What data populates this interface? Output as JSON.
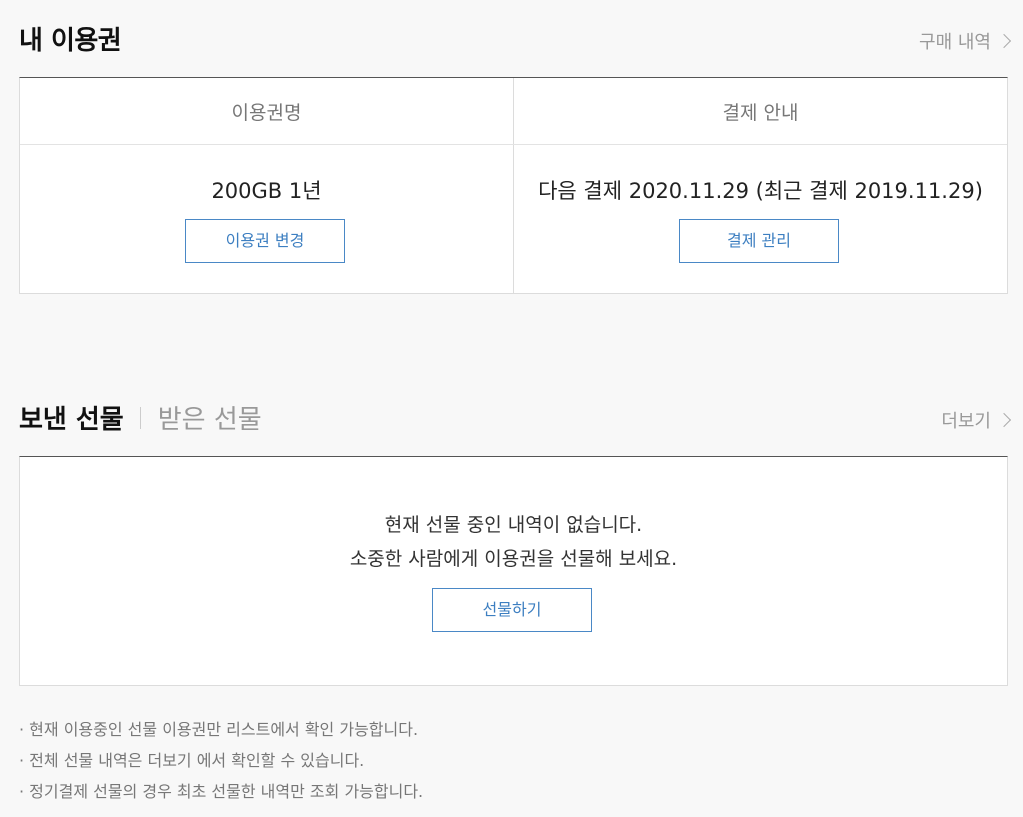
{
  "subscription": {
    "title": "내 이용권",
    "history_link": "구매 내역",
    "col_name_header": "이용권명",
    "col_payment_header": "결제 안내",
    "plan_name": "200GB 1년",
    "payment_info": "다음 결제 2020.11.29 (최근 결제 2019.11.29)",
    "change_button": "이용권 변경",
    "manage_button": "결제 관리"
  },
  "gifts": {
    "tab_sent": "보낸 선물",
    "tab_received": "받은 선물",
    "more_link": "더보기",
    "empty_line1": "현재 선물 중인 내역이 없습니다.",
    "empty_line2": "소중한 사람에게 이용권을 선물해 보세요.",
    "gift_button": "선물하기"
  },
  "notes": [
    "· 현재 이용중인 선물 이용권만 리스트에서 확인 가능합니다.",
    "· 전체 선물 내역은 더보기 에서 확인할 수 있습니다.",
    "· 정기결제 선물의 경우 최초 선물한 내역만 조회 가능합니다."
  ]
}
